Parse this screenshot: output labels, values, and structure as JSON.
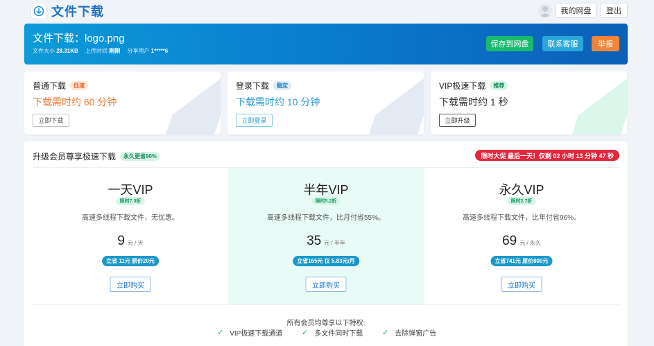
{
  "header": {
    "site_title": "文件下载",
    "my_disk_label": "我的网盘",
    "logout_label": "登出"
  },
  "banner": {
    "title": "文件下载：logo.png",
    "size_label": "文件大小",
    "size_value": "28.31KB",
    "uploaded_label": "上传时间",
    "uploaded_value": "刚刚",
    "user_label": "分享用户",
    "user_value": "1*****6",
    "save_label": "保存到网盘",
    "support_label": "联系客服",
    "report_label": "举报"
  },
  "cards": [
    {
      "title": "普通下载",
      "tag": "低速",
      "time": "下载需时约 60 分钟",
      "button": "立即下载"
    },
    {
      "title": "登录下载",
      "tag": "稳定",
      "time": "下载需时约 10 分钟",
      "button": "立即登录"
    },
    {
      "title": "VIP极速下载",
      "tag": "推荐",
      "time": "下载需时约 1 秒",
      "button": "立即升级"
    }
  ],
  "vip": {
    "title": "升级会员尊享极速下载",
    "title_tag": "永久更省90%",
    "promo": "限时大促 最后一天！仅剩 02 小时 13 分钟 47 秒",
    "plans": [
      {
        "name": "一天VIP",
        "discount": "限时7.0折",
        "desc": "高速多线程下载文件，无优惠。",
        "price": "9",
        "unit": "元 / 天",
        "save": "立省 11元 原价20元",
        "buy": "立即购买"
      },
      {
        "name": "半年VIP",
        "discount": "限时5.2折",
        "desc": "高速多线程下载文件，比月付省55%。",
        "price": "35",
        "unit": "元 / 半年",
        "save": "立省165元 仅 5.83元/月",
        "buy": "立即购买"
      },
      {
        "name": "永久VIP",
        "discount": "限时2.7折",
        "desc": "高速多线程下载文件，比年付省96%。",
        "price": "69",
        "unit": "元 / 永久",
        "save": "立省741元 原价800元",
        "buy": "立即购买"
      }
    ],
    "features_title": "所有会员均尊享以下特权:",
    "features": [
      "VIP极速下载通道",
      "多文件同时下载",
      "去除弹窗广告"
    ]
  },
  "colors": {
    "brand": "#1f6fc5",
    "save_btn": "#19b96f",
    "support_btn": "#2aa7d8",
    "report_btn": "#f2843a",
    "promo": "#e0273b"
  },
  "icons": {
    "logo": "cloud-download-icon",
    "avatar": "user-avatar-icon",
    "check": "check-icon"
  }
}
